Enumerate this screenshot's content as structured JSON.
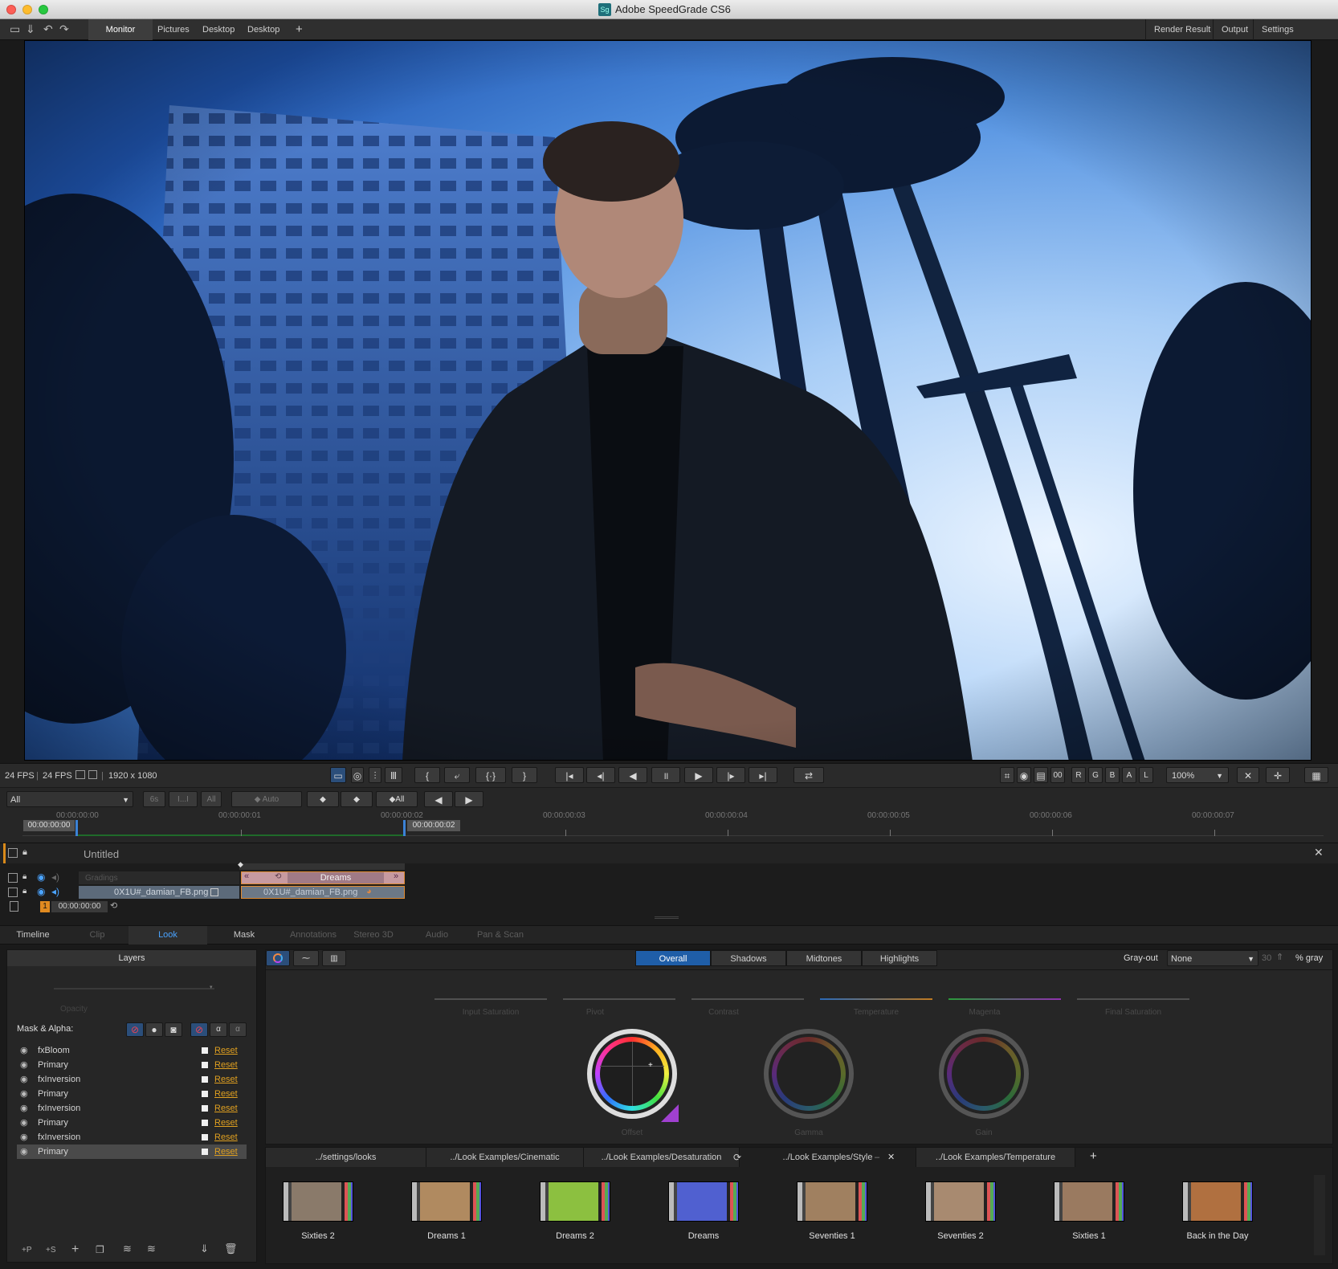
{
  "app": {
    "title": "Adobe SpeedGrade CS6"
  },
  "topbar": {
    "tabs": [
      {
        "label": "Monitor"
      },
      {
        "label": "Pictures"
      },
      {
        "label": "Desktop"
      },
      {
        "label": "Desktop"
      }
    ],
    "add": "+",
    "right": [
      {
        "label": "Render Result"
      },
      {
        "label": "Output"
      },
      {
        "label": "Settings"
      }
    ]
  },
  "status": {
    "fps1": "24 FPS",
    "fps2": "24 FPS",
    "resolution": "1920 x 1080",
    "zoom": "100%",
    "channels": [
      "R",
      "G",
      "B",
      "A",
      "L"
    ]
  },
  "timeline_ctrl": {
    "filter": "All",
    "b6s": "6s",
    "bdots": "I...I",
    "ball": "All",
    "auto": "Auto",
    "kall": "All",
    "ticks": [
      "00:00:00:00",
      "00:00:00:01",
      "00:00:00:02",
      "00:00:00:03",
      "00:00:00:04",
      "00:00:00:05",
      "00:00:00:06",
      "00:00:00:07"
    ],
    "in_tc": "00:00:00:00",
    "out_tc": "00:00:00:02"
  },
  "track": {
    "title": "Untitled",
    "gradings": "Gradings",
    "dreams": "Dreams",
    "clip1": "0X1U#_damian_FB.png",
    "clip2": "0X1U#_damian_FB.png",
    "frame": "1",
    "tc": "00:00:00:00"
  },
  "tabs": [
    {
      "label": "Timeline"
    },
    {
      "label": "Clip"
    },
    {
      "label": "Look"
    },
    {
      "label": "Mask"
    },
    {
      "label": "Annotations"
    },
    {
      "label": "Stereo 3D"
    },
    {
      "label": "Audio"
    },
    {
      "label": "Pan & Scan"
    }
  ],
  "layers": {
    "title": "Layers",
    "opacity": "Opacity",
    "mask_alpha": "Mask & Alpha:",
    "reset": "Reset",
    "items": [
      {
        "name": "fxBloom"
      },
      {
        "name": "Primary"
      },
      {
        "name": "fxInversion"
      },
      {
        "name": "Primary"
      },
      {
        "name": "fxInversion"
      },
      {
        "name": "Primary"
      },
      {
        "name": "fxInversion"
      },
      {
        "name": "Primary"
      }
    ],
    "footer": [
      "+P",
      "+S"
    ]
  },
  "grading": {
    "segments": [
      {
        "label": "Overall"
      },
      {
        "label": "Shadows"
      },
      {
        "label": "Midtones"
      },
      {
        "label": "Highlights"
      }
    ],
    "grayout_label": "Gray-out",
    "grayout_value": "None",
    "gray_num": "30",
    "gray_unit": "% gray",
    "sliders": [
      {
        "label": "Input Saturation",
        "color": "#4a4a4a"
      },
      {
        "label": "Pivot",
        "color": "#4a4a4a"
      },
      {
        "label": "Contrast",
        "color": "#4a4a4a"
      },
      {
        "label": "Temperature",
        "color": "#c07a20"
      },
      {
        "label": "Magenta",
        "color": "#9030b0"
      },
      {
        "label": "Final Saturation",
        "color": "#4a4a4a"
      }
    ],
    "wheels": [
      {
        "label": "Offset"
      },
      {
        "label": "Gamma"
      },
      {
        "label": "Gain"
      }
    ]
  },
  "look_tabs": [
    {
      "label": "../settings/looks"
    },
    {
      "label": "../Look Examples/Cinematic"
    },
    {
      "label": "../Look Examples/Desaturation"
    },
    {
      "label": "../Look Examples/Style"
    },
    {
      "label": "../Look Examples/Temperature"
    }
  ],
  "looks": [
    {
      "label": "Sixties 2",
      "tint": "#8a7a6a"
    },
    {
      "label": "Dreams 1",
      "tint": "#b08a60"
    },
    {
      "label": "Dreams 2",
      "tint": "#8cc040"
    },
    {
      "label": "Dreams",
      "tint": "#5060d0"
    },
    {
      "label": "Seventies 1",
      "tint": "#a08060"
    },
    {
      "label": "Seventies 2",
      "tint": "#a88a70"
    },
    {
      "label": "Sixties 1",
      "tint": "#9a7a60"
    },
    {
      "label": "Back in the Day",
      "tint": "#b07040"
    }
  ]
}
